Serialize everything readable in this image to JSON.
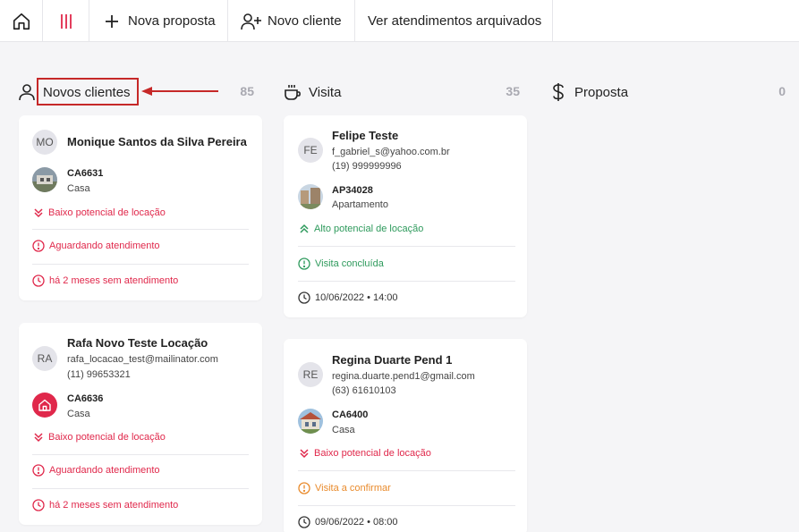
{
  "toolbar": {
    "nova_proposta": "Nova proposta",
    "novo_cliente": "Novo cliente",
    "arquivados": "Ver atendimentos arquivados"
  },
  "columns": [
    {
      "title": "Novos clientes",
      "count": "85"
    },
    {
      "title": "Visita",
      "count": "35"
    },
    {
      "title": "Proposta",
      "count": "0"
    }
  ],
  "cards": {
    "c1": {
      "initials": "MO",
      "name": "Monique Santos da Silva Pereira",
      "code": "CA6631",
      "type": "Casa",
      "potential": "Baixo potencial de locação",
      "status": "Aguardando atendimento",
      "time": "há 2 meses sem atendimento"
    },
    "c2": {
      "initials": "RA",
      "name": "Rafa Novo Teste Locação",
      "email": "rafa_locacao_test@mailinator.com",
      "phone": "(11) 99653321",
      "code": "CA6636",
      "type": "Casa",
      "potential": "Baixo potencial de locação",
      "status": "Aguardando atendimento",
      "time": "há 2 meses sem atendimento"
    },
    "v1": {
      "initials": "FE",
      "name": "Felipe Teste",
      "email": "f_gabriel_s@yahoo.com.br",
      "phone": "(19) 999999996",
      "code": "AP34028",
      "type": "Apartamento",
      "potential": "Alto potencial de locação",
      "status": "Visita concluída",
      "date": "10/06/2022 • 14:00"
    },
    "v2": {
      "initials": "RE",
      "name": "Regina Duarte Pend 1",
      "email": "regina.duarte.pend1@gmail.com",
      "phone": "(63) 61610103",
      "code": "CA6400",
      "type": "Casa",
      "potential": "Baixo potencial de locação",
      "status": "Visita a confirmar",
      "date": "09/06/2022 • 08:00"
    }
  },
  "colors": {
    "accent_red": "#e0284b",
    "success_green": "#2e9a5c",
    "warning_orange": "#e98a2b",
    "highlight_red": "#c62828"
  },
  "icons": [
    "home-icon",
    "menu-bars-icon",
    "plus-icon",
    "user-plus-icon",
    "user-icon",
    "coffee-cup-icon",
    "dollar-icon",
    "chevrons-down-icon",
    "chevrons-up-icon",
    "alert-circle-icon",
    "clock-icon",
    "house-icon"
  ]
}
